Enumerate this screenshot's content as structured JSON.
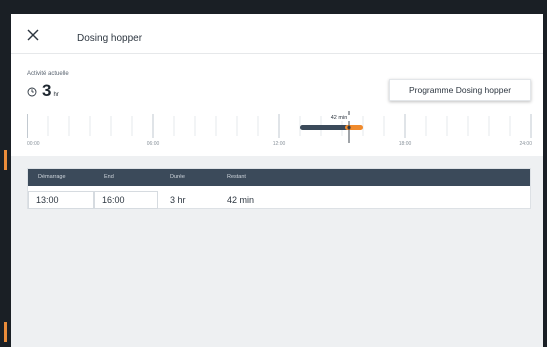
{
  "modal": {
    "title": "Dosing hopper",
    "close_icon": "close-icon"
  },
  "activity": {
    "label": "Activité actuelle",
    "value": "3",
    "unit": "hr",
    "icon": "clock-icon"
  },
  "program_button": {
    "label": "Programme Dosing hopper"
  },
  "timeline": {
    "ticks": [
      "00:00",
      "06:00",
      "12:00",
      "18:00",
      "24:00"
    ],
    "marker_label": "42 min",
    "elapsed_color": "#3b4a5a",
    "remaining_color": "#f08a2c"
  },
  "table": {
    "headers": [
      "Démarrage",
      "End",
      "Durée",
      "Restant"
    ],
    "row": {
      "start": "13:00",
      "end": "16:00",
      "duration": "3 hr",
      "remaining": "42 min"
    }
  }
}
